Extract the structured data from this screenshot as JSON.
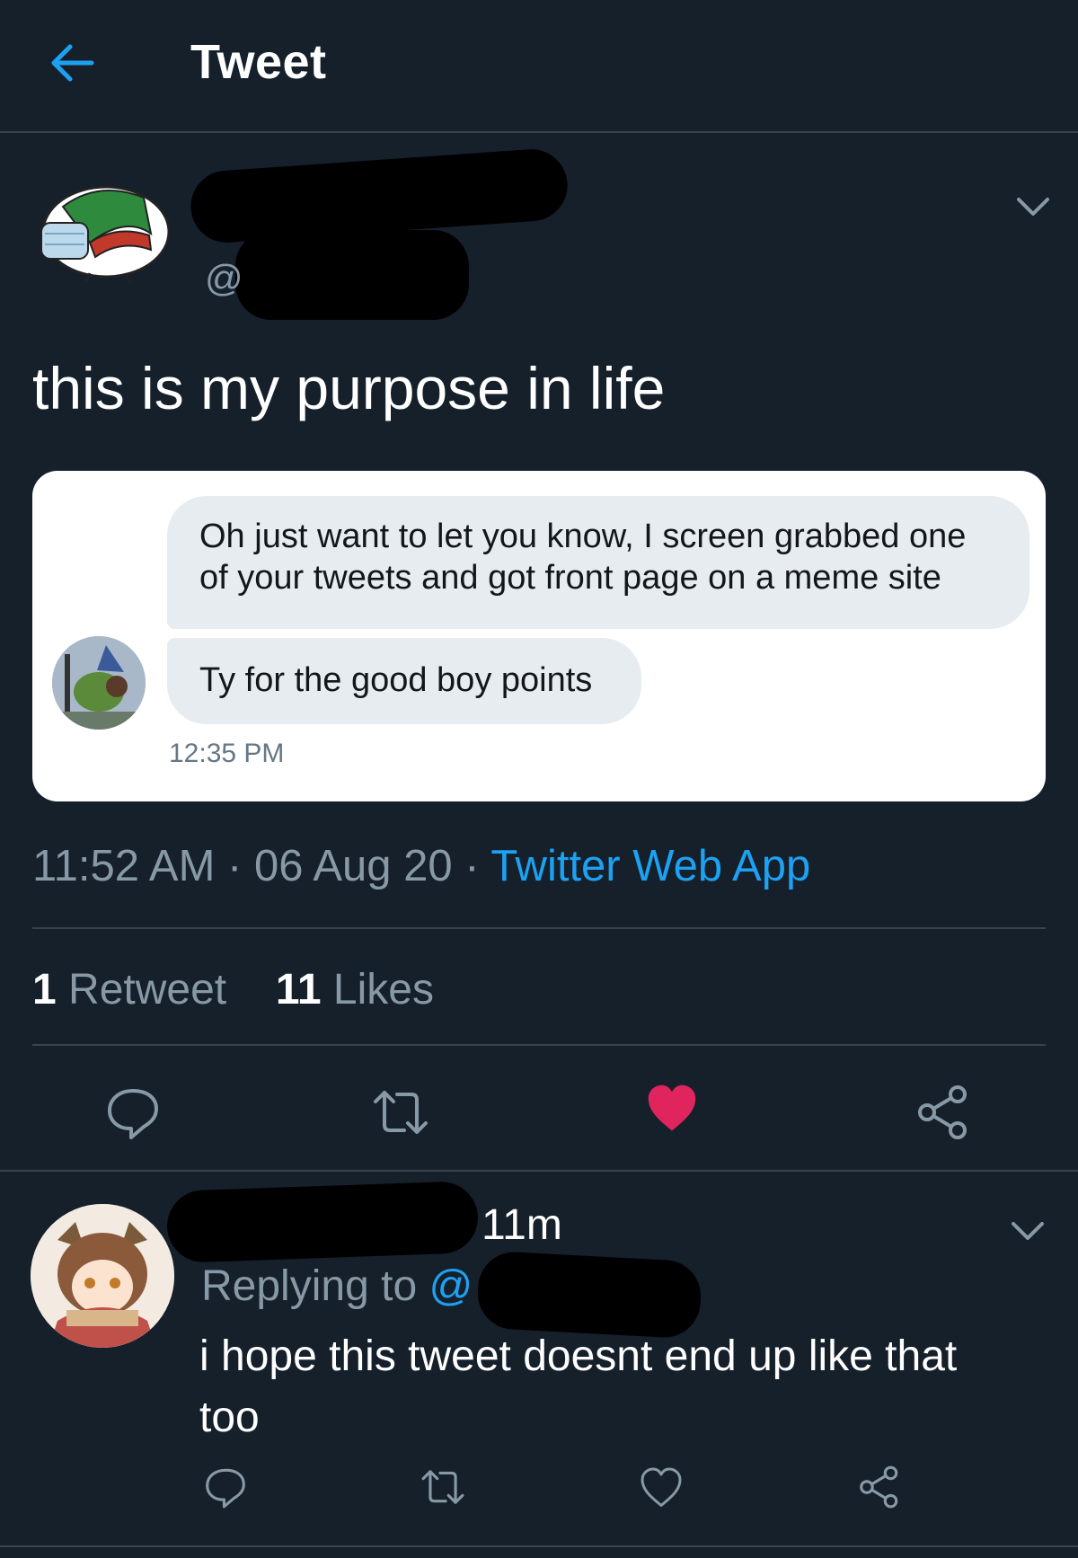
{
  "header": {
    "title": "Tweet",
    "back_icon": "arrow-left-icon"
  },
  "tweet": {
    "handle_prefix": "@",
    "text": "this is my purpose in life",
    "embedded_dm": {
      "messages": [
        "Oh just want to let you know, I screen grabbed one of your tweets and got front page on a meme site",
        "Ty for the good boy points"
      ],
      "time": "12:35 PM"
    },
    "timestamp": "11:52 AM · 06 Aug 20 · ",
    "source": "Twitter Web App",
    "retweet_count": "1",
    "retweet_label": "Retweet",
    "like_count": "11",
    "like_label": "Likes",
    "liked": true
  },
  "reply": {
    "time": "11m",
    "replying_prefix": "Replying to ",
    "replying_at": "@",
    "text": "i hope this tweet doesnt end up like that too"
  },
  "colors": {
    "background": "#15202b",
    "divider": "#38444d",
    "accent": "#1da1f2",
    "like": "#e0245e",
    "muted": "#8899a6"
  }
}
